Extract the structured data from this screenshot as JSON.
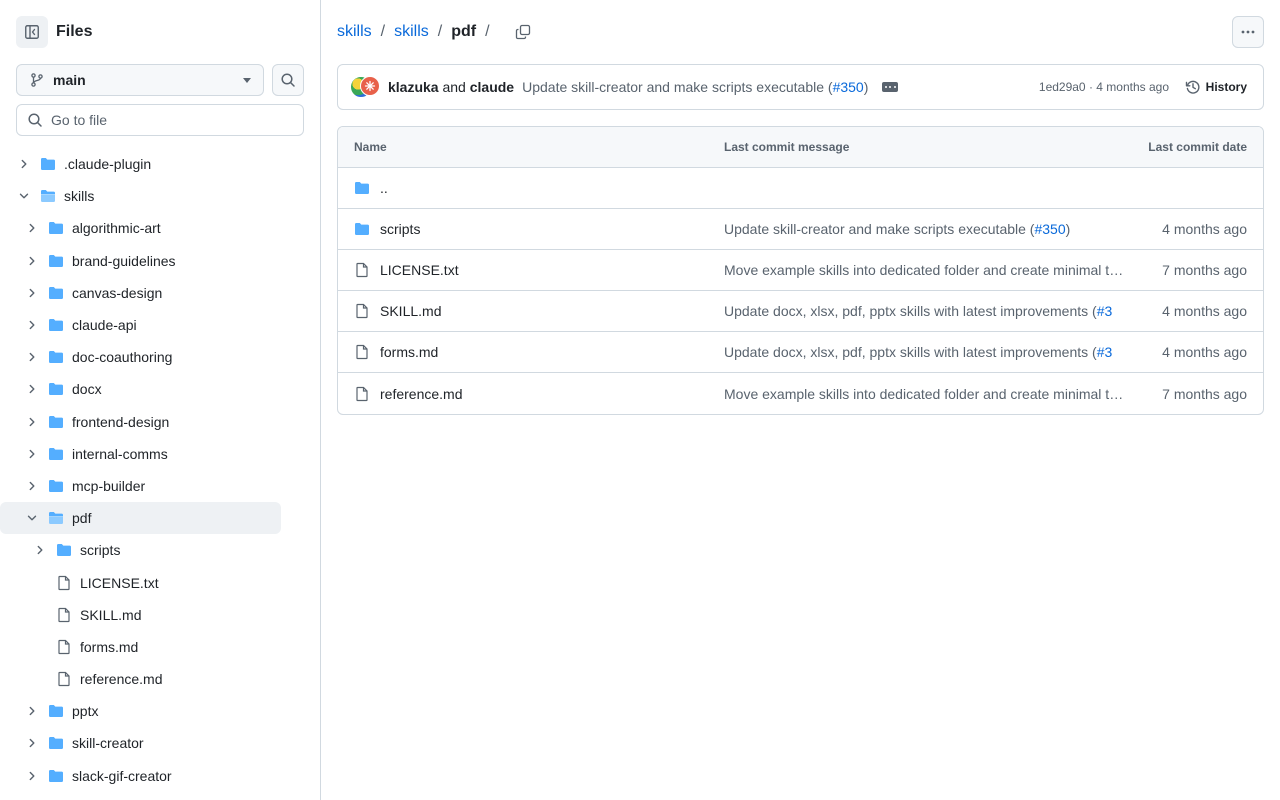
{
  "sidebar": {
    "title": "Files",
    "branch": "main",
    "goto_placeholder": "Go to file",
    "tree": [
      {
        "name": ".claude-plugin",
        "type": "folder",
        "depth": 0,
        "expanded": false
      },
      {
        "name": "skills",
        "type": "folder",
        "depth": 0,
        "expanded": true
      },
      {
        "name": "algorithmic-art",
        "type": "folder",
        "depth": 1,
        "expanded": false
      },
      {
        "name": "brand-guidelines",
        "type": "folder",
        "depth": 1,
        "expanded": false
      },
      {
        "name": "canvas-design",
        "type": "folder",
        "depth": 1,
        "expanded": false
      },
      {
        "name": "claude-api",
        "type": "folder",
        "depth": 1,
        "expanded": false
      },
      {
        "name": "doc-coauthoring",
        "type": "folder",
        "depth": 1,
        "expanded": false
      },
      {
        "name": "docx",
        "type": "folder",
        "depth": 1,
        "expanded": false
      },
      {
        "name": "frontend-design",
        "type": "folder",
        "depth": 1,
        "expanded": false
      },
      {
        "name": "internal-comms",
        "type": "folder",
        "depth": 1,
        "expanded": false
      },
      {
        "name": "mcp-builder",
        "type": "folder",
        "depth": 1,
        "expanded": false
      },
      {
        "name": "pdf",
        "type": "folder",
        "depth": 1,
        "expanded": true,
        "active": true
      },
      {
        "name": "scripts",
        "type": "folder",
        "depth": 2,
        "expanded": false
      },
      {
        "name": "LICENSE.txt",
        "type": "file",
        "depth": 2
      },
      {
        "name": "SKILL.md",
        "type": "file",
        "depth": 2
      },
      {
        "name": "forms.md",
        "type": "file",
        "depth": 2
      },
      {
        "name": "reference.md",
        "type": "file",
        "depth": 2
      },
      {
        "name": "pptx",
        "type": "folder",
        "depth": 1,
        "expanded": false
      },
      {
        "name": "skill-creator",
        "type": "folder",
        "depth": 1,
        "expanded": false
      },
      {
        "name": "slack-gif-creator",
        "type": "folder",
        "depth": 1,
        "expanded": false
      }
    ]
  },
  "breadcrumb": {
    "parts": [
      "skills",
      "skills"
    ],
    "current": "pdf",
    "separator": "/"
  },
  "commit": {
    "author1": "klazuka",
    "and": "and",
    "author2": "claude",
    "message": "Update skill-creator and make scripts executable (",
    "pr": "#350",
    "message_end": ")",
    "meta": "1ed29a0 · 4 months ago",
    "history_label": "History"
  },
  "table": {
    "headers": {
      "name": "Name",
      "message": "Last commit message",
      "date": "Last commit date"
    },
    "parent_label": "..",
    "rows": [
      {
        "name": "scripts",
        "type": "folder",
        "message": "Update skill-creator and make scripts executable (",
        "pr": "#350",
        "message_end": ")",
        "date": "4 months ago"
      },
      {
        "name": "LICENSE.txt",
        "type": "file",
        "message": "Move example skills into dedicated folder and create minimal top-level structure",
        "pr": "",
        "message_end": "",
        "date": "7 months ago"
      },
      {
        "name": "SKILL.md",
        "type": "file",
        "message": "Update docx, xlsx, pdf, pptx skills with latest improvements (",
        "pr": "#3",
        "message_end": "",
        "date": "4 months ago"
      },
      {
        "name": "forms.md",
        "type": "file",
        "message": "Update docx, xlsx, pdf, pptx skills with latest improvements (",
        "pr": "#3",
        "message_end": "",
        "date": "4 months ago"
      },
      {
        "name": "reference.md",
        "type": "file",
        "message": "Move example skills into dedicated folder and create minimal top-level structure",
        "pr": "",
        "message_end": "",
        "date": "7 months ago"
      }
    ]
  },
  "colors": {
    "accent": "#0969da",
    "folder": "#54aeff",
    "muted": "#59636e",
    "border": "#d1d9e0"
  }
}
